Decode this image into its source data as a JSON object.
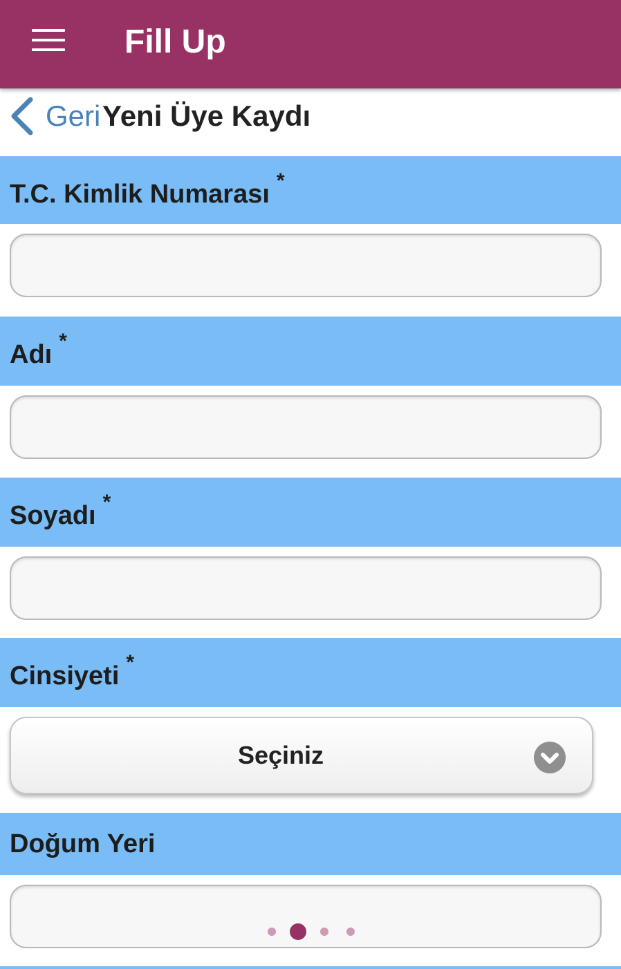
{
  "app_bar": {
    "menu_icon": "hamburger-menu-icon",
    "title": "Fill Up",
    "background_color": "#993264"
  },
  "subheader": {
    "back_icon": "chevron-left-icon",
    "back_label": "Geri",
    "page_title": "Yeni Üye Kaydı"
  },
  "form": {
    "section_color": "#79bcf6",
    "required_marker": "*",
    "fields": [
      {
        "label": "T.C. Kimlik Numarası",
        "required": true,
        "type": "text",
        "value": ""
      },
      {
        "label": "Adı",
        "required": true,
        "type": "text",
        "value": ""
      },
      {
        "label": "Soyadı",
        "required": true,
        "type": "text",
        "value": ""
      },
      {
        "label": "Cinsiyeti",
        "required": true,
        "type": "select",
        "selected": "Seçiniz",
        "icon": "chevron-down-circle-icon"
      },
      {
        "label": "Doğum Yeri",
        "required": false,
        "type": "text",
        "value": ""
      }
    ]
  },
  "pager": {
    "count": 4,
    "active_index": 1,
    "active_color": "#993264",
    "inactive_color": "#cf9ab3"
  }
}
